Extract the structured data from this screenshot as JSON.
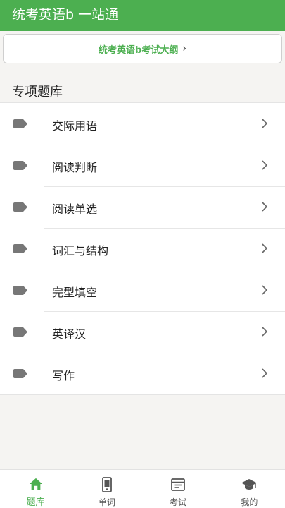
{
  "header": {
    "title": "统考英语b 一站通"
  },
  "outline_button": {
    "label": "统考英语b考试大纲",
    "chevron": "›"
  },
  "section": {
    "title": "专项题库"
  },
  "categories": [
    {
      "label": "交际用语",
      "icon": "tag-icon"
    },
    {
      "label": "阅读判断",
      "icon": "tag-icon"
    },
    {
      "label": "阅读单选",
      "icon": "tag-icon"
    },
    {
      "label": "词汇与结构",
      "icon": "tag-icon"
    },
    {
      "label": "完型填空",
      "icon": "tag-icon"
    },
    {
      "label": "英译汉",
      "icon": "tag-icon"
    },
    {
      "label": "写作",
      "icon": "tag-icon"
    }
  ],
  "tabbar": {
    "tabs": [
      {
        "label": "题库",
        "icon": "home-icon",
        "active": true
      },
      {
        "label": "单词",
        "icon": "phone-icon",
        "active": false
      },
      {
        "label": "考试",
        "icon": "form-icon",
        "active": false
      },
      {
        "label": "我的",
        "icon": "graduation-cap-icon",
        "active": false
      }
    ]
  },
  "colors": {
    "accent": "#4caf50",
    "background": "#f5f4f2",
    "icon_gray": "#777777"
  }
}
